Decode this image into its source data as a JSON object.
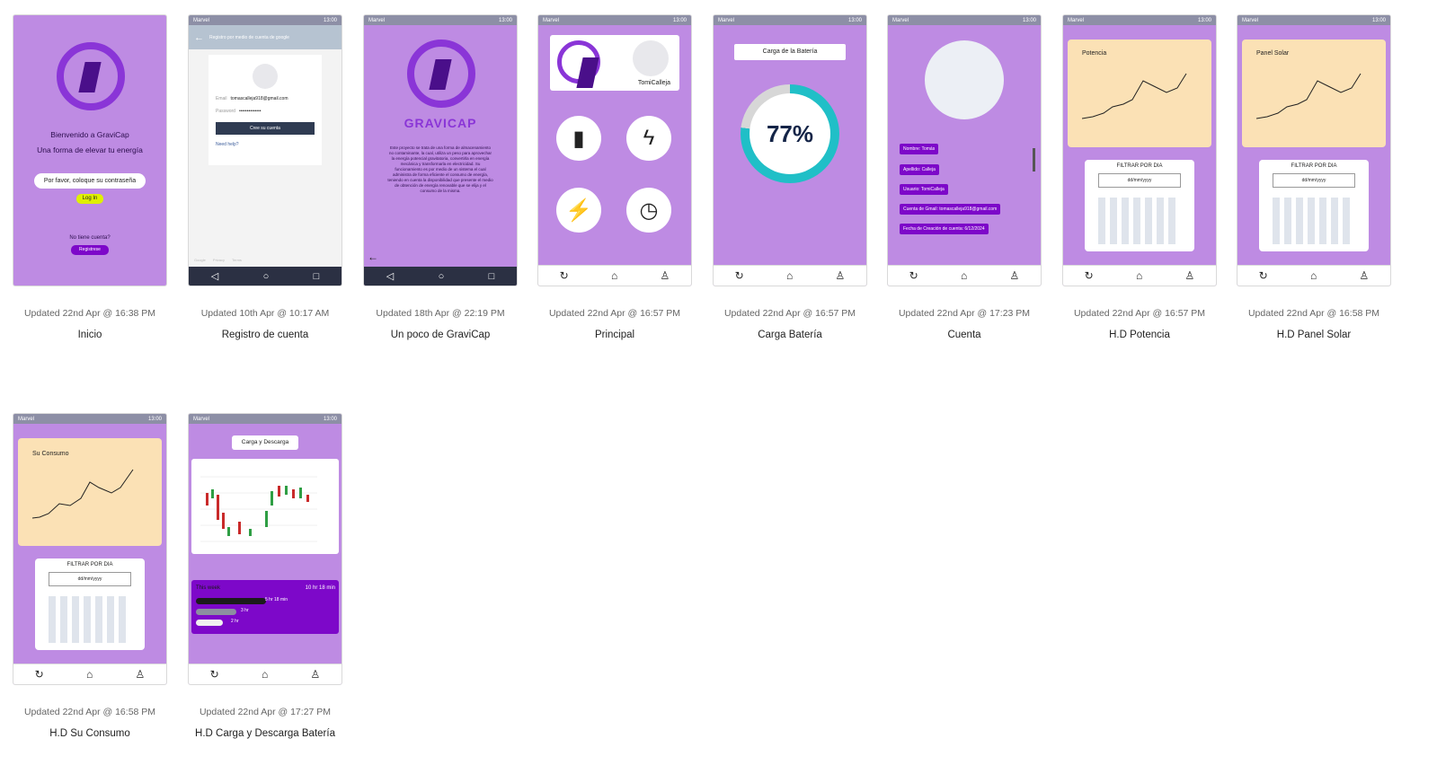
{
  "screens": [
    {
      "id": "inicio",
      "updated": "Updated 22nd Apr @ 16:38 PM",
      "title": "Inicio",
      "welcome": "Bienvenido a GraviCap",
      "tagline": "Una forma de elevar tu energía",
      "password_prompt": "Por favor, coloque su contraseña",
      "login_label": "Log In",
      "no_account": "No tiene cuenta?",
      "register_label": "Registrese"
    },
    {
      "id": "registro",
      "updated": "Updated 10th Apr @ 10:17 AM",
      "title": "Registro de cuenta",
      "topbar": "Registro por medio de cuenta de google",
      "email_label": "Email",
      "email_value": "tomascalleja918@gmail.com",
      "password_label": "Password",
      "password_value": "••••••••••••••",
      "create_label": "Cree su cuenta",
      "help_label": "Need help?",
      "footer": [
        "Google",
        "Privacy",
        "Terms"
      ]
    },
    {
      "id": "gravicap",
      "updated": "Updated 18th Apr @ 22:19 PM",
      "title": "Un poco de GraviCap",
      "brand": "GRAVICAP",
      "description": "Este proyecto se trata de una forma de almacenamiento no contaminante, la cual, utiliza un peso para aprovechar la energía potencial gravitatoria, convertirla en energía mecánica y transformarla en electricidad. Su funcionamiento es por medio de un sistema el cual administra de forma eficiente el consumo de energía, teniendo en cuenta la disponibilidad que presente el medio de obtención de energía renovable que se elija y el consumo de la misma."
    },
    {
      "id": "principal",
      "updated": "Updated 22nd Apr @ 16:57 PM",
      "title": "Principal",
      "username": "TomiCalleja"
    },
    {
      "id": "bateria",
      "updated": "Updated 22nd Apr @ 16:57 PM",
      "title": "Carga Batería",
      "header": "Carga de la Batería",
      "percent": "77%",
      "level": 0.77
    },
    {
      "id": "cuenta",
      "updated": "Updated 22nd Apr @ 17:23 PM",
      "title": "Cuenta",
      "fields": [
        "Nombre: Tomás",
        "Apellido: Calleja",
        "Usuario: TomiCalleja",
        "Cuenta de Gmail: tomascalleja918@gmail.com",
        "Fecha de Creación de cuenta: 6/12/2024"
      ]
    },
    {
      "id": "potencia",
      "updated": "Updated 22nd Apr @ 16:57 PM",
      "title": "H.D Potencia",
      "chart_title": "Potencia",
      "filter": "FILTRAR POR DIA",
      "date_placeholder": "dd/mm/yyyy"
    },
    {
      "id": "panel",
      "updated": "Updated 22nd Apr @ 16:58 PM",
      "title": "H.D Panel Solar",
      "chart_title": "Panel Solar",
      "filter": "FILTRAR POR DIA",
      "date_placeholder": "dd/mm/yyyy"
    },
    {
      "id": "consumo",
      "updated": "Updated 22nd Apr @ 16:58 PM",
      "title": "H.D Su Consumo",
      "chart_title": "Su Consumo",
      "filter": "FILTRAR POR DIA",
      "date_placeholder": "dd/mm/yyyy"
    },
    {
      "id": "carga_descarga",
      "updated": "Updated 22nd Apr @ 17:27 PM",
      "title": "H.D Carga y Descarga Batería",
      "header": "Carga y Descarga",
      "week_label": "This week",
      "week_total": "10 hr 18 min",
      "bars": [
        {
          "label": "5 hr 18 min",
          "fraction": 0.52
        },
        {
          "label": "3 hr",
          "fraction": 0.3
        },
        {
          "label": "2 hr",
          "fraction": 0.2
        }
      ]
    }
  ],
  "status": {
    "carrier": "Marvel",
    "time": "13:00"
  }
}
